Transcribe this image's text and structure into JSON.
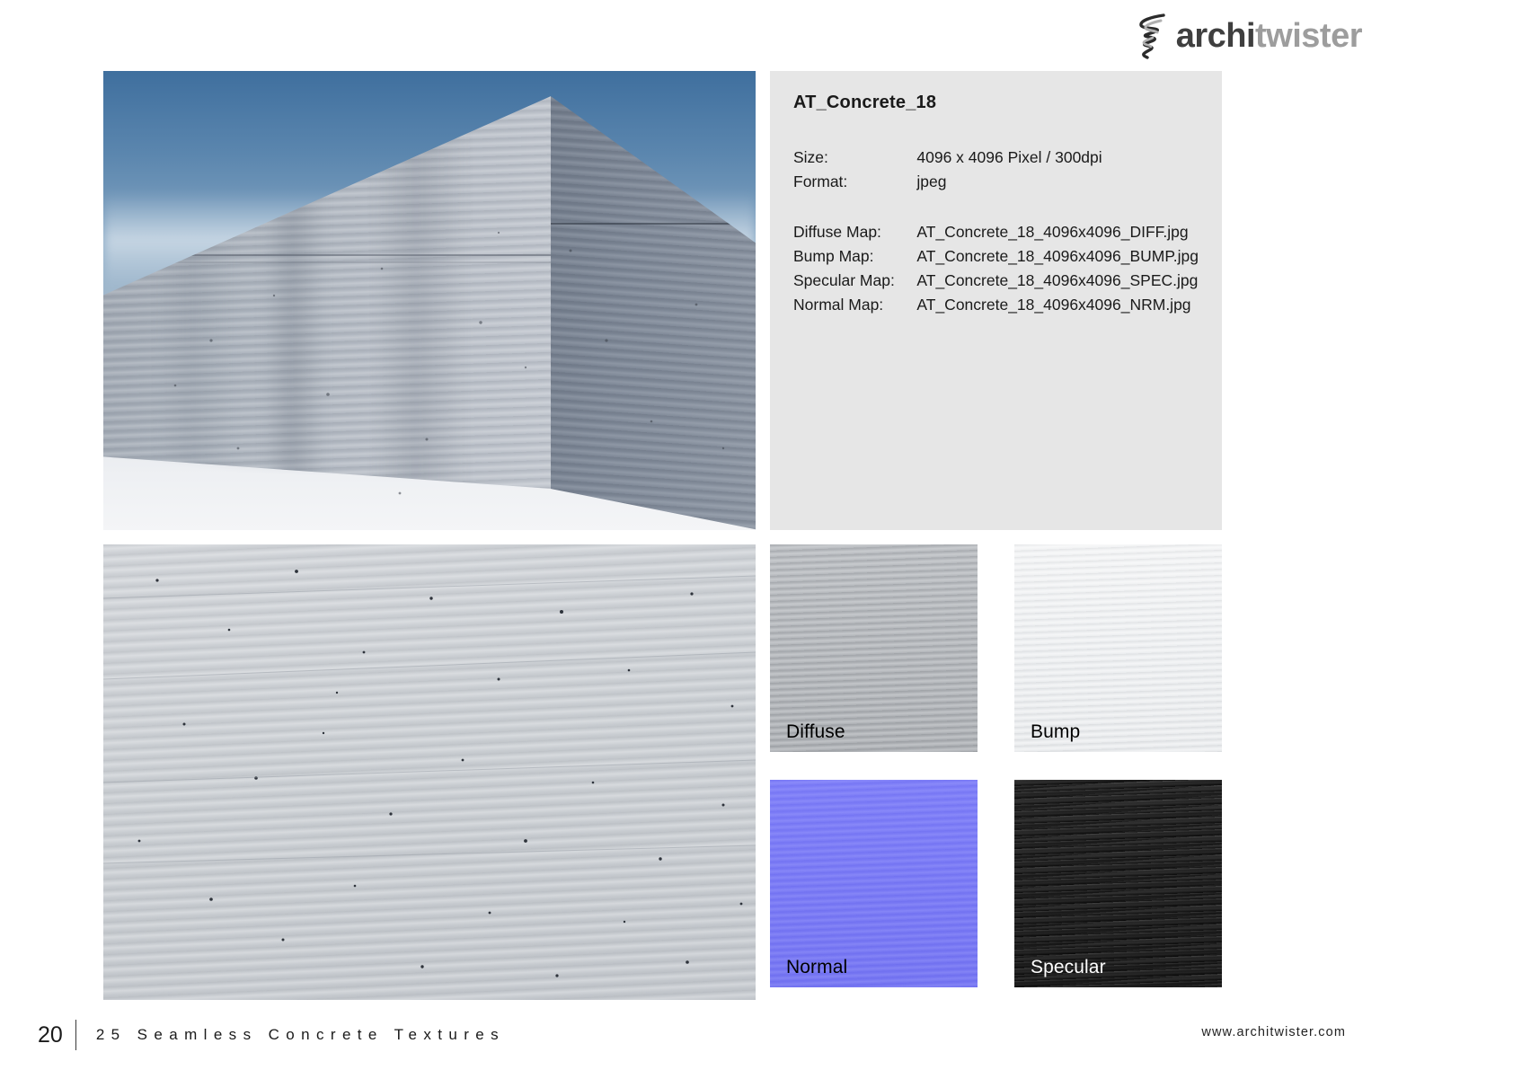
{
  "brand": {
    "logo_icon": "twister-spiral-icon",
    "name_part_1": "archi",
    "name_part_2": "twister",
    "color_dark": "#3f3f3f",
    "color_light": "#9d9d9d"
  },
  "hero": {
    "image_name": "concrete-block-render",
    "alt": "Rendered concrete block with board-formed texture against blue sky"
  },
  "info": {
    "title": "AT_Concrete_18",
    "rows": [
      {
        "key": "Size:",
        "value": "4096 x 4096 Pixel / 300dpi"
      },
      {
        "key": "Format:",
        "value": "jpeg"
      }
    ],
    "maps": [
      {
        "key": "Diffuse Map:",
        "value": "AT_Concrete_18_4096x4096_DIFF.jpg"
      },
      {
        "key": "Bump Map:",
        "value": "AT_Concrete_18_4096x4096_BUMP.jpg"
      },
      {
        "key": "Specular Map:",
        "value": "AT_Concrete_18_4096x4096_SPEC.jpg"
      },
      {
        "key": "Normal Map:",
        "value": "AT_Concrete_18_4096x4096_NRM.jpg"
      }
    ],
    "background_color": "#e6e6e6"
  },
  "detail": {
    "image_name": "concrete-texture-detail",
    "alt": "Close-up of light grey board-formed concrete surface"
  },
  "swatches": [
    {
      "label": "Diffuse",
      "name": "diffuse-map-swatch",
      "label_color": "#000000",
      "base_color": "#b2b5b9"
    },
    {
      "label": "Bump",
      "name": "bump-map-swatch",
      "label_color": "#000000",
      "base_color": "#eceef0"
    },
    {
      "label": "Normal",
      "name": "normal-map-swatch",
      "label_color": "#000000",
      "base_color": "#7878f4"
    },
    {
      "label": "Specular",
      "name": "specular-map-swatch",
      "label_color": "#ffffff",
      "base_color": "#1a1a1a"
    }
  ],
  "footer": {
    "page_number": "20",
    "title": "25 Seamless Concrete Textures",
    "url": "www.architwister.com"
  }
}
